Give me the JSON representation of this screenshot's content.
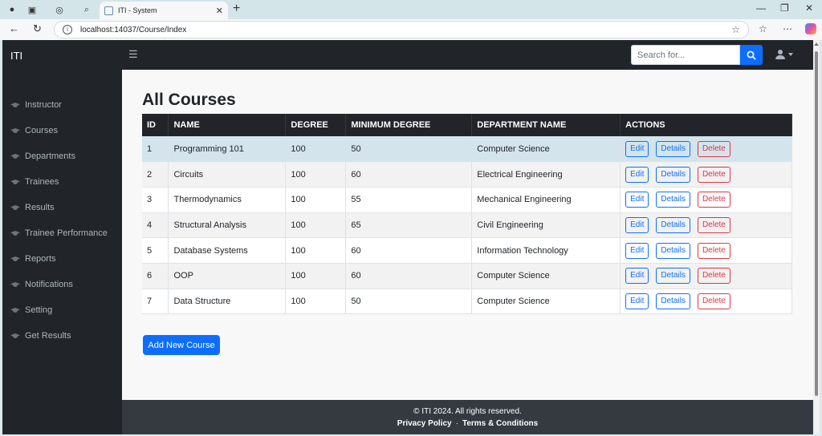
{
  "browser": {
    "tab_title": "ITI - System",
    "url": "localhost:14037/Course/Index"
  },
  "app": {
    "brand": "ITI",
    "search_placeholder": "Search for..."
  },
  "sidebar": {
    "items": [
      {
        "label": "Instructor"
      },
      {
        "label": "Courses"
      },
      {
        "label": "Departments"
      },
      {
        "label": "Trainees"
      },
      {
        "label": "Results"
      },
      {
        "label": "Trainee Performance"
      },
      {
        "label": "Reports"
      },
      {
        "label": "Notifications"
      },
      {
        "label": "Setting"
      },
      {
        "label": "Get Results"
      }
    ]
  },
  "main": {
    "title": "All Courses",
    "columns": [
      "ID",
      "NAME",
      "DEGREE",
      "MINIMUM DEGREE",
      "DEPARTMENT NAME",
      "ACTIONS"
    ],
    "rows": [
      {
        "id": "1",
        "name": "Programming 101",
        "degree": "100",
        "min_degree": "50",
        "department": "Computer Science"
      },
      {
        "id": "2",
        "name": "Circuits",
        "degree": "100",
        "min_degree": "60",
        "department": "Electrical Engineering"
      },
      {
        "id": "3",
        "name": "Thermodynamics",
        "degree": "100",
        "min_degree": "55",
        "department": "Mechanical Engineering"
      },
      {
        "id": "4",
        "name": "Structural Analysis",
        "degree": "100",
        "min_degree": "65",
        "department": "Civil Engineering"
      },
      {
        "id": "5",
        "name": "Database Systems",
        "degree": "100",
        "min_degree": "60",
        "department": "Information Technology"
      },
      {
        "id": "6",
        "name": "OOP",
        "degree": "100",
        "min_degree": "60",
        "department": "Computer Science"
      },
      {
        "id": "7",
        "name": "Data Structure",
        "degree": "100",
        "min_degree": "50",
        "department": "Computer Science"
      }
    ],
    "actions": {
      "edit": "Edit",
      "details": "Details",
      "delete": "Delete"
    },
    "add_button": "Add New Course"
  },
  "footer": {
    "copyright": "© ITI 2024. All rights reserved.",
    "privacy": "Privacy Policy",
    "separator": "·",
    "terms": "Terms & Conditions"
  },
  "colors": {
    "primary": "#0d6efd",
    "danger": "#dc3545",
    "dark": "#212529",
    "highlight_row": "#d3e4ed"
  }
}
